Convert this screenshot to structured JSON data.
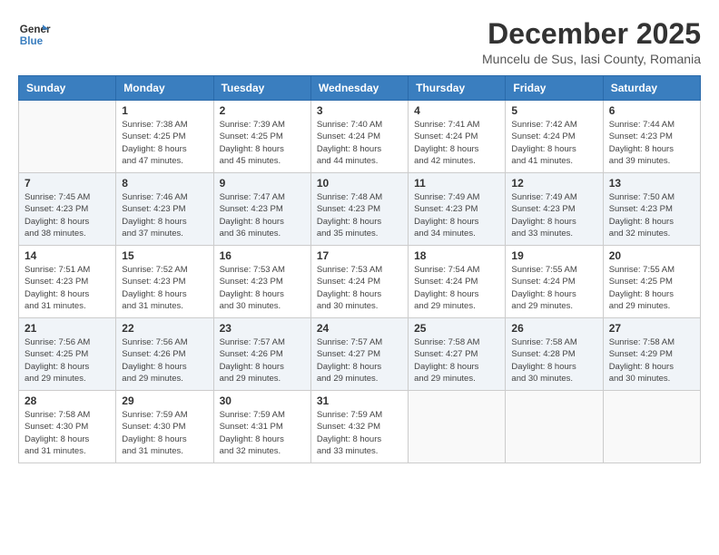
{
  "logo": {
    "line1": "General",
    "line2": "Blue"
  },
  "title": "December 2025",
  "location": "Muncelu de Sus, Iasi County, Romania",
  "headers": [
    "Sunday",
    "Monday",
    "Tuesday",
    "Wednesday",
    "Thursday",
    "Friday",
    "Saturday"
  ],
  "weeks": [
    [
      {
        "day": "",
        "info": ""
      },
      {
        "day": "1",
        "info": "Sunrise: 7:38 AM\nSunset: 4:25 PM\nDaylight: 8 hours\nand 47 minutes."
      },
      {
        "day": "2",
        "info": "Sunrise: 7:39 AM\nSunset: 4:25 PM\nDaylight: 8 hours\nand 45 minutes."
      },
      {
        "day": "3",
        "info": "Sunrise: 7:40 AM\nSunset: 4:24 PM\nDaylight: 8 hours\nand 44 minutes."
      },
      {
        "day": "4",
        "info": "Sunrise: 7:41 AM\nSunset: 4:24 PM\nDaylight: 8 hours\nand 42 minutes."
      },
      {
        "day": "5",
        "info": "Sunrise: 7:42 AM\nSunset: 4:24 PM\nDaylight: 8 hours\nand 41 minutes."
      },
      {
        "day": "6",
        "info": "Sunrise: 7:44 AM\nSunset: 4:23 PM\nDaylight: 8 hours\nand 39 minutes."
      }
    ],
    [
      {
        "day": "7",
        "info": "Sunrise: 7:45 AM\nSunset: 4:23 PM\nDaylight: 8 hours\nand 38 minutes."
      },
      {
        "day": "8",
        "info": "Sunrise: 7:46 AM\nSunset: 4:23 PM\nDaylight: 8 hours\nand 37 minutes."
      },
      {
        "day": "9",
        "info": "Sunrise: 7:47 AM\nSunset: 4:23 PM\nDaylight: 8 hours\nand 36 minutes."
      },
      {
        "day": "10",
        "info": "Sunrise: 7:48 AM\nSunset: 4:23 PM\nDaylight: 8 hours\nand 35 minutes."
      },
      {
        "day": "11",
        "info": "Sunrise: 7:49 AM\nSunset: 4:23 PM\nDaylight: 8 hours\nand 34 minutes."
      },
      {
        "day": "12",
        "info": "Sunrise: 7:49 AM\nSunset: 4:23 PM\nDaylight: 8 hours\nand 33 minutes."
      },
      {
        "day": "13",
        "info": "Sunrise: 7:50 AM\nSunset: 4:23 PM\nDaylight: 8 hours\nand 32 minutes."
      }
    ],
    [
      {
        "day": "14",
        "info": "Sunrise: 7:51 AM\nSunset: 4:23 PM\nDaylight: 8 hours\nand 31 minutes."
      },
      {
        "day": "15",
        "info": "Sunrise: 7:52 AM\nSunset: 4:23 PM\nDaylight: 8 hours\nand 31 minutes."
      },
      {
        "day": "16",
        "info": "Sunrise: 7:53 AM\nSunset: 4:23 PM\nDaylight: 8 hours\nand 30 minutes."
      },
      {
        "day": "17",
        "info": "Sunrise: 7:53 AM\nSunset: 4:24 PM\nDaylight: 8 hours\nand 30 minutes."
      },
      {
        "day": "18",
        "info": "Sunrise: 7:54 AM\nSunset: 4:24 PM\nDaylight: 8 hours\nand 29 minutes."
      },
      {
        "day": "19",
        "info": "Sunrise: 7:55 AM\nSunset: 4:24 PM\nDaylight: 8 hours\nand 29 minutes."
      },
      {
        "day": "20",
        "info": "Sunrise: 7:55 AM\nSunset: 4:25 PM\nDaylight: 8 hours\nand 29 minutes."
      }
    ],
    [
      {
        "day": "21",
        "info": "Sunrise: 7:56 AM\nSunset: 4:25 PM\nDaylight: 8 hours\nand 29 minutes."
      },
      {
        "day": "22",
        "info": "Sunrise: 7:56 AM\nSunset: 4:26 PM\nDaylight: 8 hours\nand 29 minutes."
      },
      {
        "day": "23",
        "info": "Sunrise: 7:57 AM\nSunset: 4:26 PM\nDaylight: 8 hours\nand 29 minutes."
      },
      {
        "day": "24",
        "info": "Sunrise: 7:57 AM\nSunset: 4:27 PM\nDaylight: 8 hours\nand 29 minutes."
      },
      {
        "day": "25",
        "info": "Sunrise: 7:58 AM\nSunset: 4:27 PM\nDaylight: 8 hours\nand 29 minutes."
      },
      {
        "day": "26",
        "info": "Sunrise: 7:58 AM\nSunset: 4:28 PM\nDaylight: 8 hours\nand 30 minutes."
      },
      {
        "day": "27",
        "info": "Sunrise: 7:58 AM\nSunset: 4:29 PM\nDaylight: 8 hours\nand 30 minutes."
      }
    ],
    [
      {
        "day": "28",
        "info": "Sunrise: 7:58 AM\nSunset: 4:30 PM\nDaylight: 8 hours\nand 31 minutes."
      },
      {
        "day": "29",
        "info": "Sunrise: 7:59 AM\nSunset: 4:30 PM\nDaylight: 8 hours\nand 31 minutes."
      },
      {
        "day": "30",
        "info": "Sunrise: 7:59 AM\nSunset: 4:31 PM\nDaylight: 8 hours\nand 32 minutes."
      },
      {
        "day": "31",
        "info": "Sunrise: 7:59 AM\nSunset: 4:32 PM\nDaylight: 8 hours\nand 33 minutes."
      },
      {
        "day": "",
        "info": ""
      },
      {
        "day": "",
        "info": ""
      },
      {
        "day": "",
        "info": ""
      }
    ]
  ]
}
